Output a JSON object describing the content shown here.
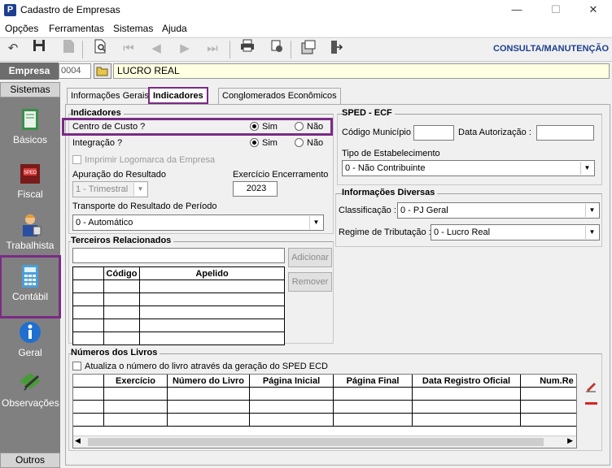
{
  "window": {
    "title": "Cadastro de Empresas",
    "app_icon": "P",
    "controls": [
      "—",
      "☐",
      "✕"
    ]
  },
  "menu": [
    "Opções",
    "Ferramentas",
    "Sistemas",
    "Ajuda"
  ],
  "toolbar": {
    "mode": "CONSULTA/MANUTENÇÃO"
  },
  "empresa": {
    "label": "Empresa",
    "code": "0004",
    "name": "LUCRO REAL"
  },
  "sidebar": {
    "header": "Sistemas",
    "footer": "Outros",
    "items": [
      {
        "label": "Básicos",
        "icon": "book-icon"
      },
      {
        "label": "Fiscal",
        "icon": "sped-book-icon"
      },
      {
        "label": "Trabalhista",
        "icon": "worker-icon"
      },
      {
        "label": "Contábil",
        "icon": "calculator-icon"
      },
      {
        "label": "Geral",
        "icon": "info-icon"
      },
      {
        "label": "Observações",
        "icon": "notes-icon"
      }
    ]
  },
  "tabs": [
    "Informações Gerais",
    "Indicadores",
    "Conglomerados Econômicos"
  ],
  "indicadores": {
    "title": "Indicadores",
    "centro_custo_label": "Centro de Custo ?",
    "integracao_label": "Integração ?",
    "sim": "Sim",
    "nao": "Não",
    "imprimir_logo": "Imprimir Logomarca da Empresa",
    "apuracao_label": "Apuração do Resultado",
    "apuracao_value": "1 - Trimestral",
    "exercicio_label": "Exercício Encerramento",
    "exercicio_value": "2023",
    "transporte_label": "Transporte do Resultado de Período",
    "transporte_value": "0 - Automático"
  },
  "sped": {
    "title": "SPED - ECF",
    "codigo_municipio_label": "Código Município :",
    "codigo_municipio_value": "",
    "data_autorizacao_label": "Data Autorização :",
    "data_autorizacao_value": "",
    "tipo_label": "Tipo de Estabelecimento",
    "tipo_value": "0 - Não Contribuinte"
  },
  "info_diversas": {
    "title": "Informações Diversas",
    "classificacao_label": "Classificação :",
    "classificacao_value": "0 - PJ Geral",
    "regime_label": "Regime de Tributação :",
    "regime_value": "0 - Lucro Real"
  },
  "terceiros": {
    "title": "Terceiros Relacionados",
    "adicionar": "Adicionar",
    "remover": "Remover",
    "columns": [
      "",
      "Código",
      "Apelido"
    ]
  },
  "livros": {
    "title": "Números dos Livros",
    "checkbox_label": "Atualiza o número do livro através da geração do SPED ECD",
    "columns": [
      "",
      "Exercício",
      "Número do Livro",
      "Página Inicial",
      "Página Final",
      "Data Registro Oficial",
      "Num.Re"
    ]
  },
  "colors": {
    "highlight": "#7b2a86",
    "brand": "#1e3f8f"
  }
}
